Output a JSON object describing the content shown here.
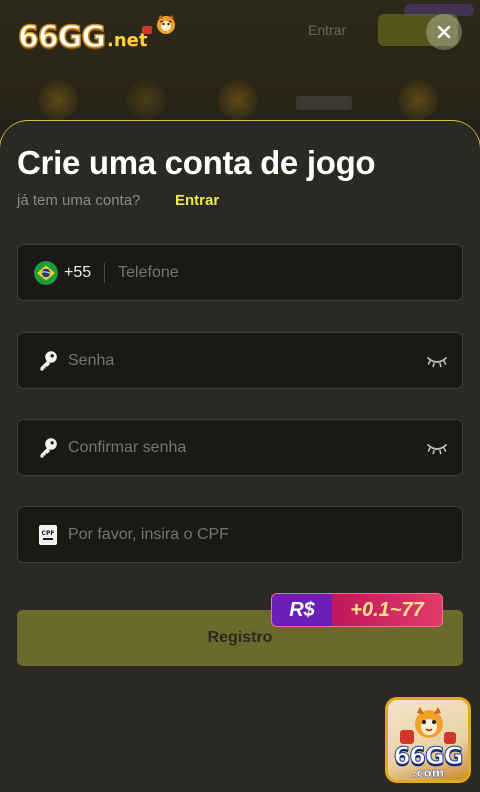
{
  "header": {
    "logo_main": "66GG",
    "logo_sub": ".net",
    "ghost_text": "Entrar",
    "close_icon": "close-icon"
  },
  "form": {
    "title": "Crie uma conta de jogo",
    "subtitle": "já tem uma conta?",
    "login_link": "Entrar",
    "phone": {
      "flag_icon": "brazil-flag-icon",
      "dial_code": "+55",
      "placeholder": "Telefone"
    },
    "password": {
      "icon": "key-icon",
      "placeholder": "Senha",
      "toggle_icon": "eye-closed-icon"
    },
    "confirm_password": {
      "icon": "key-icon",
      "placeholder": "Confirmar senha",
      "toggle_icon": "eye-closed-icon"
    },
    "cpf": {
      "icon": "cpf-card-icon",
      "placeholder": "Por favor, insira o CPF"
    },
    "register_label": "Registro",
    "bonus": {
      "currency": "R$",
      "value": "+0.1~77"
    }
  },
  "app_badge": {
    "main": "66GG",
    "sub": ".com"
  },
  "colors": {
    "accent": "#e8ea4e",
    "panel_bg": "#2a2923",
    "field_bg": "#1a1915",
    "register_bg": "#6b6a2d",
    "bonus_purple": "#6a1fb8",
    "bonus_pink": "#d62a62"
  }
}
